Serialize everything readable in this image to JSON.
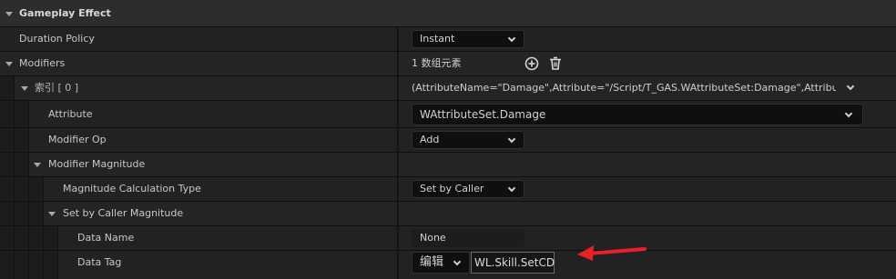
{
  "header": {
    "title": "Gameplay Effect"
  },
  "rows": {
    "duration_policy": {
      "label": "Duration Policy",
      "value": "Instant"
    },
    "modifiers": {
      "label": "Modifiers",
      "count_text": "1 数组元素"
    },
    "index0": {
      "label": "索引 [ 0 ]",
      "summary": "(AttributeName=\"Damage\",Attribute=\"/Script/T_GAS.WAttributeSet:Damage\",AttributeOwner"
    },
    "attribute": {
      "label": "Attribute",
      "value": "WAttributeSet.Damage"
    },
    "modifier_op": {
      "label": "Modifier Op",
      "value": "Add"
    },
    "modifier_magnitude": {
      "label": "Modifier Magnitude"
    },
    "magnitude_calc_type": {
      "label": "Magnitude Calculation Type",
      "value": "Set by Caller"
    },
    "set_by_caller_magnitude": {
      "label": "Set by Caller Magnitude"
    },
    "data_name": {
      "label": "Data Name",
      "value": "None"
    },
    "data_tag": {
      "label": "Data Tag",
      "edit_label": "编辑",
      "tag_value": "WL.Skill.SetCD"
    }
  },
  "icons": {
    "add": "plus-circle-icon",
    "delete": "trash-icon",
    "annotation": "red-arrow"
  },
  "colors": {
    "accent_arrow": "#e8202a",
    "background": "#1a1a1a",
    "row": "#222222",
    "header": "#2d2d2d"
  }
}
